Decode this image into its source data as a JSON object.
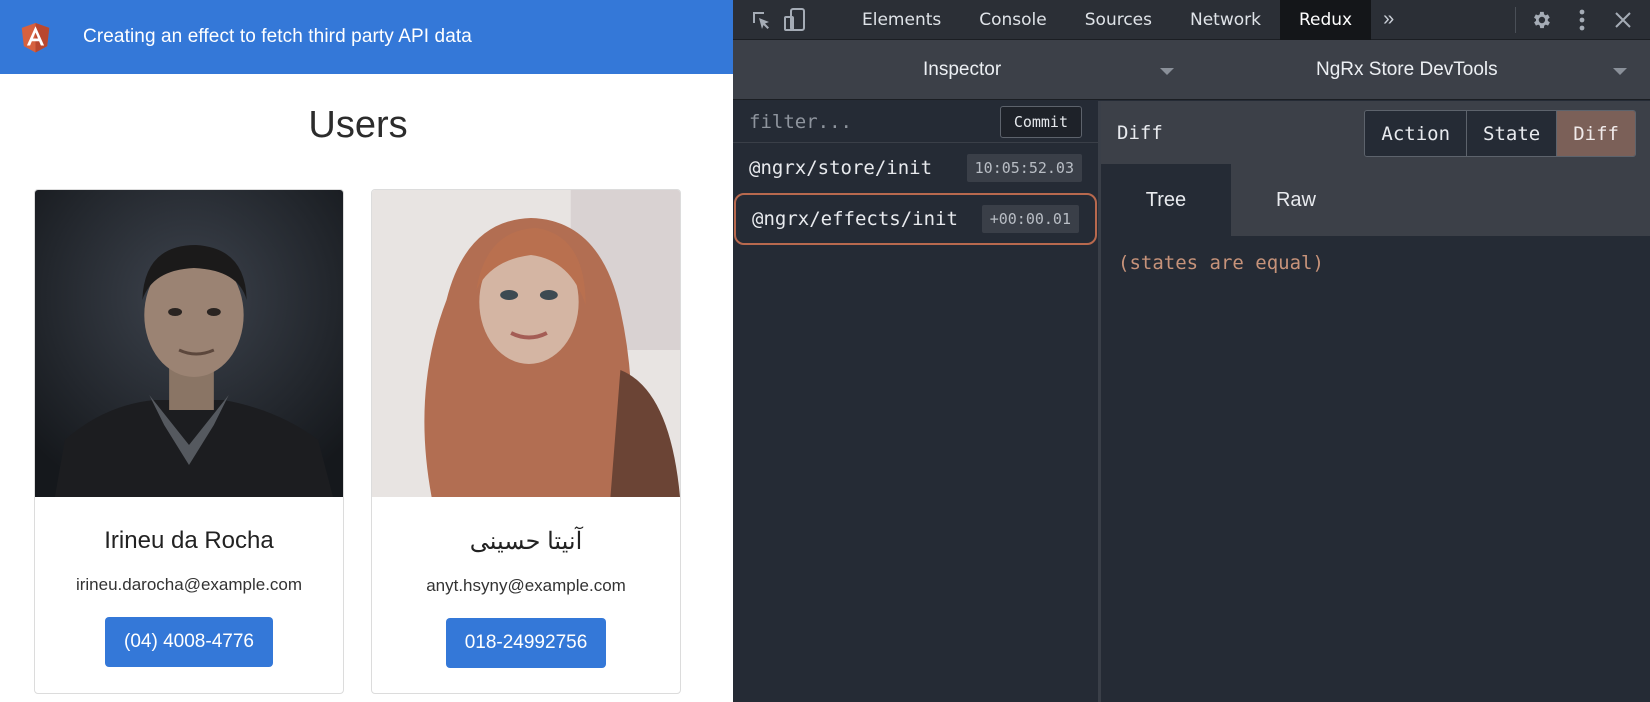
{
  "app": {
    "title": "Creating an effect to fetch third party API data",
    "heading": "Users",
    "users": [
      {
        "name": "Irineu da Rocha",
        "email": "irineu.darocha@example.com",
        "phone": "(04) 4008-4776"
      },
      {
        "name": "آنیتا حسینی",
        "email": "anyt.hsyny@example.com",
        "phone": "018-24992756"
      }
    ]
  },
  "devtools": {
    "tabs": [
      "Elements",
      "Console",
      "Sources",
      "Network",
      "Redux"
    ],
    "active_tab": "Redux",
    "monitor_label": "Inspector",
    "instance_label": "NgRx Store DevTools",
    "filter_placeholder": "filter...",
    "commit_label": "Commit",
    "actions": [
      {
        "type": "@ngrx/store/init",
        "time": "10:05:52.03"
      },
      {
        "type": "@ngrx/effects/init",
        "time": "+00:00.01"
      }
    ],
    "panel_title": "Diff",
    "view_buttons": [
      "Action",
      "State",
      "Diff"
    ],
    "active_view": "Diff",
    "subtabs": [
      "Tree",
      "Raw"
    ],
    "active_subtab": "Tree",
    "diff_message": "(states are equal)"
  },
  "colors": {
    "angular_blue": "#3478d8",
    "selected_outline": "#b8694e",
    "diff_text": "#c7937a"
  }
}
